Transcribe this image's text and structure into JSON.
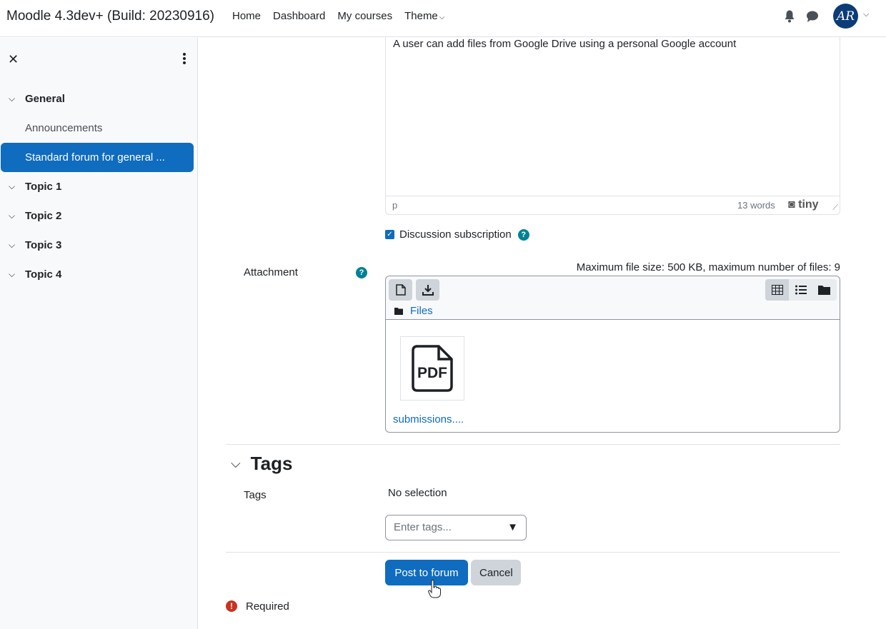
{
  "navbar": {
    "brand": "Moodle 4.3dev+ (Build: 20230916)",
    "links": [
      "Home",
      "Dashboard",
      "My courses"
    ],
    "theme_label": "Theme",
    "avatar_initials": "AR"
  },
  "drawer": {
    "items": [
      {
        "label": "General",
        "type": "section"
      },
      {
        "label": "Announcements",
        "type": "activity"
      },
      {
        "label": "Standard forum for general ...",
        "type": "activity-active"
      },
      {
        "label": "Topic 1",
        "type": "section"
      },
      {
        "label": "Topic 2",
        "type": "section"
      },
      {
        "label": "Topic 3",
        "type": "section"
      },
      {
        "label": "Topic 4",
        "type": "section"
      }
    ]
  },
  "editor": {
    "content": "A user can add files from Google Drive using a personal Google account",
    "status_path": "p",
    "word_count": "13 words",
    "brand": "tiny"
  },
  "subscription": {
    "label": "Discussion subscription",
    "checked": true
  },
  "attachment": {
    "label": "Attachment",
    "max_size_text": "Maximum file size: 500 KB, maximum number of files: 9",
    "path_label": "Files",
    "file_name": "submissions....",
    "file_type": "PDF"
  },
  "tags": {
    "heading": "Tags",
    "field_label": "Tags",
    "selection": "No selection",
    "placeholder": "Enter tags..."
  },
  "actions": {
    "submit": "Post to forum",
    "cancel": "Cancel"
  },
  "required_note": "Required"
}
